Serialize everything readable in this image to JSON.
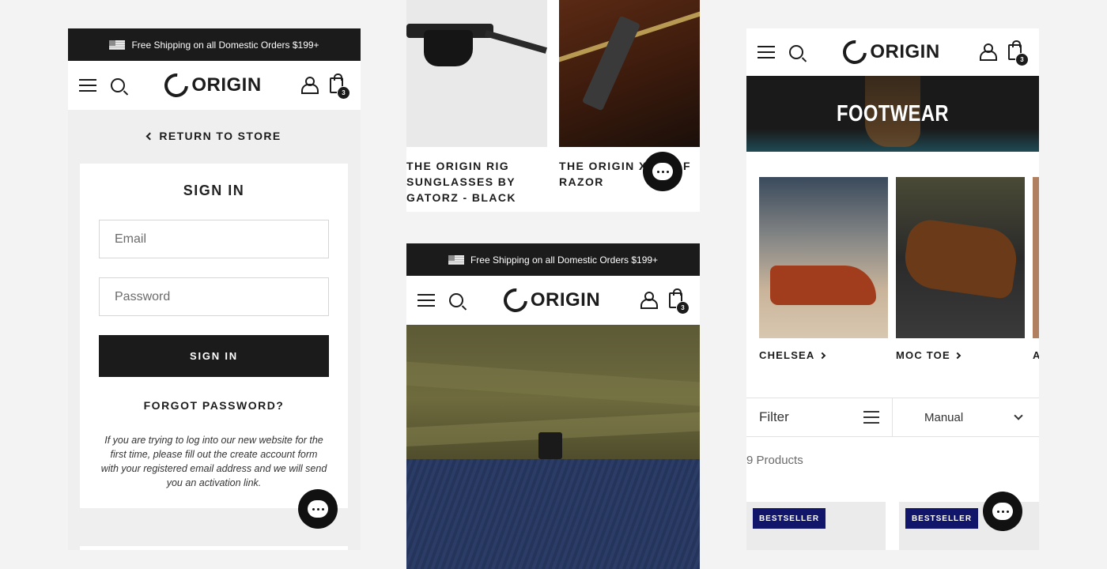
{
  "promo": {
    "text": "Free Shipping on all Domestic Orders $199+"
  },
  "brand": {
    "name": "ORIGIN"
  },
  "cart": {
    "count": "3"
  },
  "signin_panel": {
    "return_label": "RETURN TO STORE",
    "heading": "SIGN IN",
    "email_placeholder": "Email",
    "password_placeholder": "Password",
    "submit_label": "SIGN IN",
    "forgot_label": "FORGOT PASSWORD?",
    "help_text": "If you are trying to log into our new website for the first time, please fill out the create account form with your registered email address and we will send you an activation link."
  },
  "products": {
    "items": [
      {
        "title": "THE ORIGIN RIG SUNGLASSES BY GATORZ - BLACK"
      },
      {
        "title": "THE ORIGIN X",
        "title_tail": "F",
        "title_line2": "RAZOR"
      }
    ]
  },
  "footwear": {
    "banner": "FOOTWEAR",
    "categories": [
      {
        "label": "CHELSEA"
      },
      {
        "label": "MOC TOE"
      },
      {
        "label": "A"
      }
    ],
    "filter_label": "Filter",
    "sort_value": "Manual",
    "count_text": "9 Products",
    "badges": [
      "BESTSELLER",
      "BESTSELLER"
    ]
  },
  "colors": {
    "dark": "#1b1b1b",
    "badge_navy": "#12166b",
    "light_gray": "#ebebeb"
  }
}
